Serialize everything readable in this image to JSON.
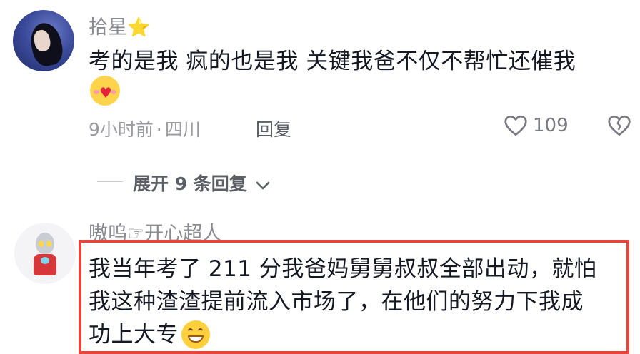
{
  "comments": [
    {
      "username": "拾星",
      "username_badge": "⭐",
      "text": "考的是我 疯的也是我 关键我爸不仅不帮忙还催我",
      "emoji": "smiling-face-holding-heart",
      "time": "9小时前",
      "location": "四川",
      "reply_label": "回复",
      "like_count": "109",
      "expand_label": "展开 9 条回复",
      "expand_icon": "chevron-down-icon"
    },
    {
      "username": "嗷呜☞开心超人",
      "text_line1": "我当年考了 211 分我爸妈舅舅叔叔全部出动，就怕",
      "text_line2": "我这种渣渣提前流入市场了，在他们的努力下我成",
      "text_line3": "功上大专",
      "emoji": "grinning-face",
      "highlight_color": "#e8453c"
    }
  ],
  "meta_separator": "·"
}
